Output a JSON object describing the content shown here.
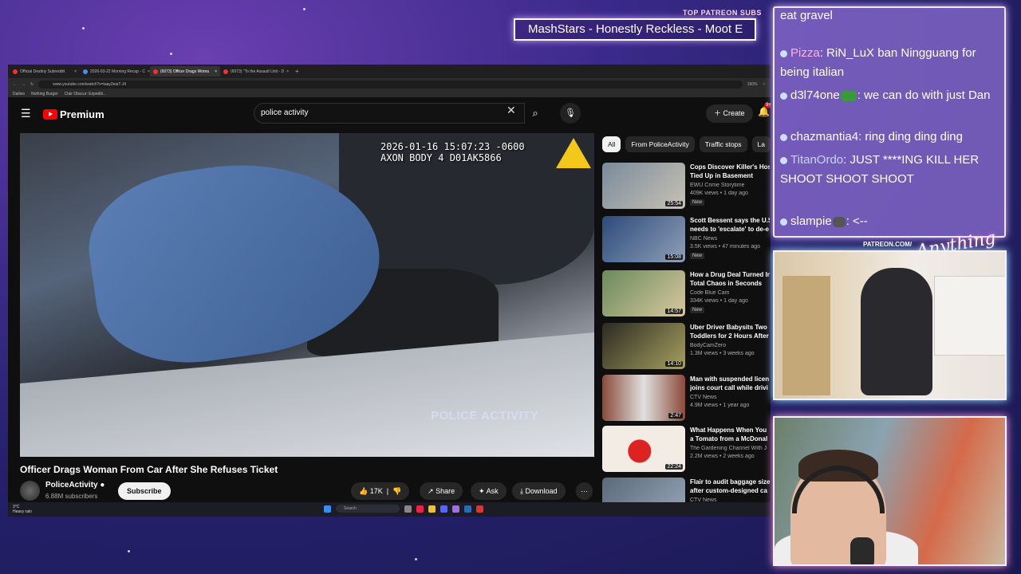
{
  "overlay": {
    "patreon_label": "TOP PATREON SUBS",
    "ticker_text": "MashStars - Honestly Reckless - Moot E",
    "patreon_url": "PATREON.COM/",
    "signature": "Anything else"
  },
  "browser": {
    "tabs": [
      {
        "label": "Official Destiny Subreddit"
      },
      {
        "label": "2026-03-22 Morning Recap - C"
      },
      {
        "label": "(6073) Officer Drags Woma"
      },
      {
        "label": "(6073) \"To the Assault Unit - D"
      }
    ],
    "new_tab": "+",
    "url": "www.youtube.com/watch?v=taay2eiaT-J4",
    "zoom": "160%",
    "bookmarks": [
      "Dailies",
      "Nothing Burger",
      "Clair Obscur: Expediti..."
    ]
  },
  "youtube": {
    "brand": "Premium",
    "search_value": "police activity",
    "create_label": "Create",
    "notif_count": "9+",
    "video": {
      "timestamp_line1": "2026-01-16 15:07:23 -0600",
      "timestamp_line2": "AXON BODY 4 D01AK5866",
      "watermark": "POLICE ACTIVITY",
      "title": "Officer Drags Woman From Car After She Refuses Ticket"
    },
    "channel": {
      "name": "PoliceActivity",
      "subs": "6.88M subscribers",
      "subscribe_label": "Subscribe"
    },
    "actions": {
      "likes": "17K",
      "share": "Share",
      "ask": "Ask",
      "download": "Download",
      "more": "⋯"
    },
    "chips": [
      "All",
      "From PoliceActivity",
      "Traffic stops",
      "La"
    ],
    "recommended": [
      {
        "title": "Cops Discover Killer's Hos",
        "title2": "Tied Up in Basement",
        "channel": "EWU Crime Storytime",
        "meta": "409K views • 1 day ago",
        "new": "New",
        "duration": "25:54",
        "color": "#7a8a9a"
      },
      {
        "title": "Scott Bessent says the U.S",
        "title2": "needs to 'escalate' to de-e",
        "channel": "NBC News",
        "meta": "3.5K views • 47 minutes ago",
        "new": "New",
        "duration": "15:08",
        "color": "#3a5a8a"
      },
      {
        "title": "How a Drug Deal Turned In",
        "title2": "Total Chaos in Seconds",
        "channel": "Code Blue Cam",
        "meta": "334K views • 1 day ago",
        "new": "New",
        "duration": "14:57",
        "color": "#6a8a5a"
      },
      {
        "title": "Uber Driver Babysits Two",
        "title2": "Toddlers for 2 Hours After",
        "channel": "BodyCamZero",
        "meta": "1.3M views • 3 weeks ago",
        "new": "",
        "duration": "14:10",
        "color": "#4a4a3a"
      },
      {
        "title": "Man with suspended licen",
        "title2": "joins court call while drivi",
        "channel": "CTV News",
        "meta": "4.9M views • 1 year ago",
        "new": "",
        "duration": "2:47",
        "color": "#8a4a3a"
      },
      {
        "title": "What Happens When You",
        "title2": "a Tomato from a McDonal",
        "channel": "The Gardening Channel With J",
        "meta": "2.2M views • 2 weeks ago",
        "new": "",
        "duration": "22:24",
        "color": "#d8d0c4"
      },
      {
        "title": "Flair to audit baggage size",
        "title2": "after custom-designed ca",
        "channel": "CTV News",
        "meta": "",
        "new": "",
        "duration": "",
        "color": "#5a6a7a"
      }
    ]
  },
  "taskbar": {
    "weather_temp": "3°C",
    "weather_desc": "Heavy rain",
    "search_label": "Search"
  },
  "chat": {
    "messages": [
      {
        "user": "",
        "text": "eat gravel"
      },
      {
        "user": "Pizza",
        "text": ": RiN_LuX ban Ningguang for being italian"
      },
      {
        "user": "d3l74one",
        "text": ": we can do with just Dan"
      },
      {
        "user": "chazmantia4",
        "text": ": ring ding ding ding"
      },
      {
        "user": "TitanOrdo",
        "text": ": JUST ****ING KILL HER SHOOT SHOOT SHOOT"
      },
      {
        "user": "slampie",
        "text": ": <--"
      }
    ]
  }
}
